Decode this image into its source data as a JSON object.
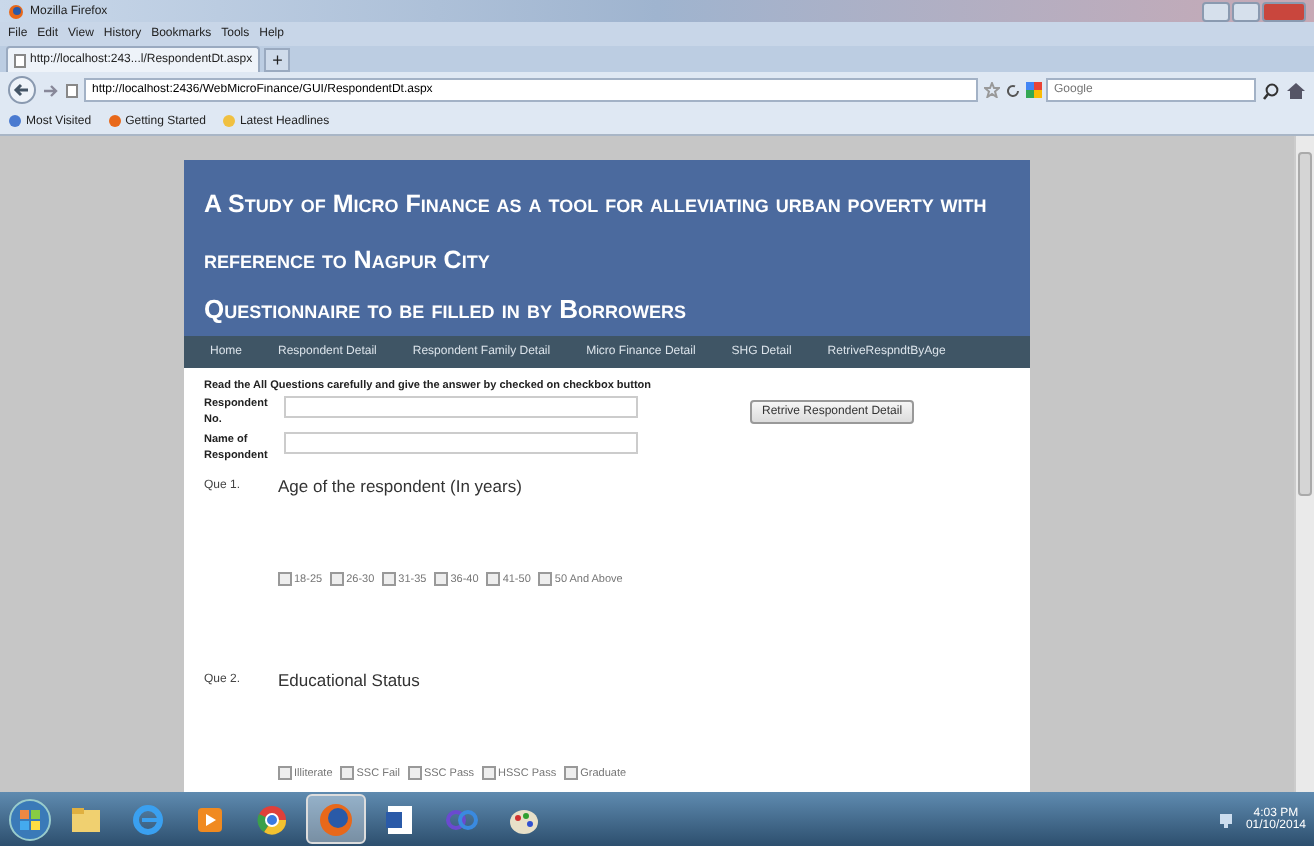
{
  "window": {
    "title": "Mozilla Firefox"
  },
  "menu": [
    "File",
    "Edit",
    "View",
    "History",
    "Bookmarks",
    "Tools",
    "Help"
  ],
  "tabs": [
    {
      "label": "http://localhost:243...l/RespondentDt.aspx",
      "selected": true
    }
  ],
  "new_tab": "+",
  "address": {
    "value": "http://localhost:2436/WebMicroFinance/GUI/RespondentDt.aspx"
  },
  "search": {
    "placeholder": "Google"
  },
  "bookmarks": [
    "Most Visited",
    "Getting Started",
    "Latest Headlines"
  ],
  "page": {
    "title": "A Study of Micro Finance as a tool for alleviating urban poverty with reference to Nagpur City",
    "subtitle": "Questionnaire to be filled in by Borrowers",
    "nav": [
      "Home",
      "Respondent Detail",
      "Respondent Family Detail",
      "Micro Finance Detail",
      "SHG Detail",
      "RetriveRespndtByAge"
    ],
    "instruction": "Read the All Questions carefully and give the answer by checked on checkbox button",
    "fields": [
      {
        "label": "Respondent No."
      },
      {
        "label": "Name of Respondent"
      }
    ],
    "retrieve_button": "Retrive Respondent Detail",
    "questions": [
      {
        "number": "Que 1.",
        "text": "Age of the respondent (In years)",
        "options": [
          {
            "label": "18-25",
            "checked": false
          },
          {
            "label": "26-30",
            "checked": false
          },
          {
            "label": "31-35",
            "checked": false
          },
          {
            "label": "36-40",
            "checked": false
          },
          {
            "label": "41-50",
            "checked": false
          },
          {
            "label": "50 And Above",
            "checked": false
          }
        ]
      },
      {
        "number": "Que 2.",
        "text": "Educational Status",
        "options": [
          {
            "label": "Illiterate",
            "checked": false
          },
          {
            "label": "SSC Fail",
            "checked": false
          },
          {
            "label": "SSC Pass",
            "checked": false
          },
          {
            "label": "HSSC Pass",
            "checked": false
          },
          {
            "label": "Graduate",
            "checked": false
          }
        ]
      }
    ]
  },
  "taskbar": {
    "apps": [
      {
        "kind": "folder"
      },
      {
        "kind": "ie"
      },
      {
        "kind": "media"
      },
      {
        "kind": "chrome"
      },
      {
        "kind": "firefox",
        "selected": true
      },
      {
        "kind": "word",
        "selected": false
      },
      {
        "kind": "rings",
        "selected": false
      },
      {
        "kind": "paint",
        "selected": false
      }
    ],
    "time": "4:03 PM",
    "date": "01/10/2014"
  }
}
